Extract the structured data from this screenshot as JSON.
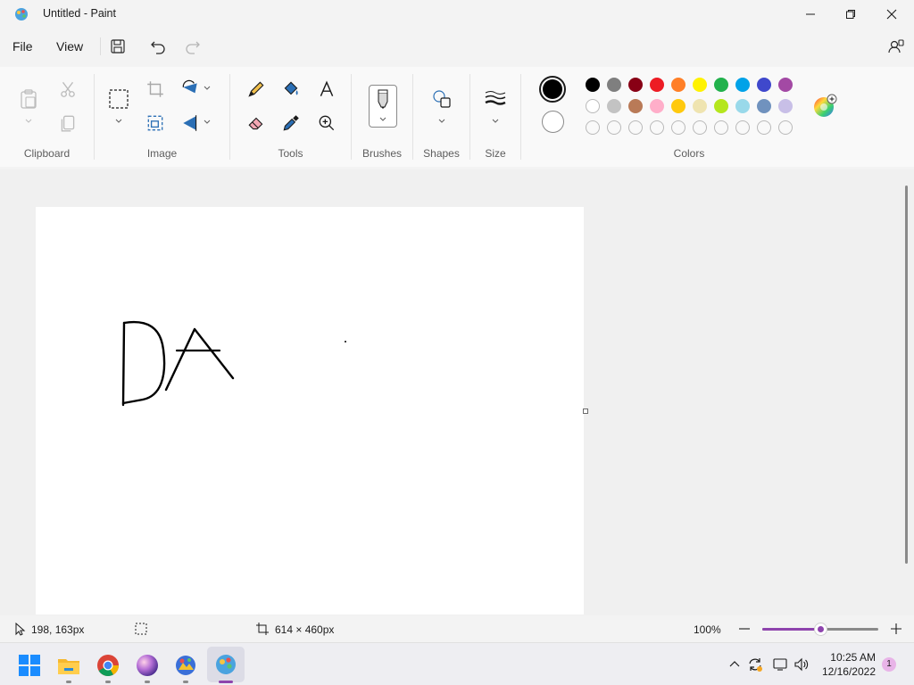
{
  "window": {
    "title": "Untitled - Paint"
  },
  "menu": {
    "file": "File",
    "view": "View"
  },
  "ribbon": {
    "groups": {
      "clipboard": "Clipboard",
      "image": "Image",
      "tools": "Tools",
      "brushes": "Brushes",
      "shapes": "Shapes",
      "size": "Size",
      "colors": "Colors"
    }
  },
  "colors": {
    "primary": "#000000",
    "secondary": "#ffffff",
    "palette_row1": [
      "#000000",
      "#7f7f7f",
      "#880015",
      "#ed1c24",
      "#ff7f27",
      "#fff200",
      "#22b14c",
      "#00a2e8",
      "#3f48cc",
      "#a349a4"
    ],
    "palette_row2": [
      "#ffffff",
      "#c3c3c3",
      "#b97a57",
      "#ffaec9",
      "#ffc90e",
      "#efe4b0",
      "#b5e61d",
      "#99d9ea",
      "#7092be",
      "#c8bfe7"
    ],
    "palette_row3_count": 10,
    "accent": "#8e44ad"
  },
  "status": {
    "cursor_position": "198, 163px",
    "canvas_size": "614 × 460px",
    "zoom": "100%",
    "zoom_level": 0.5
  },
  "taskbar": {
    "time": "10:25 AM",
    "date": "12/16/2022",
    "notification_count": "1"
  }
}
